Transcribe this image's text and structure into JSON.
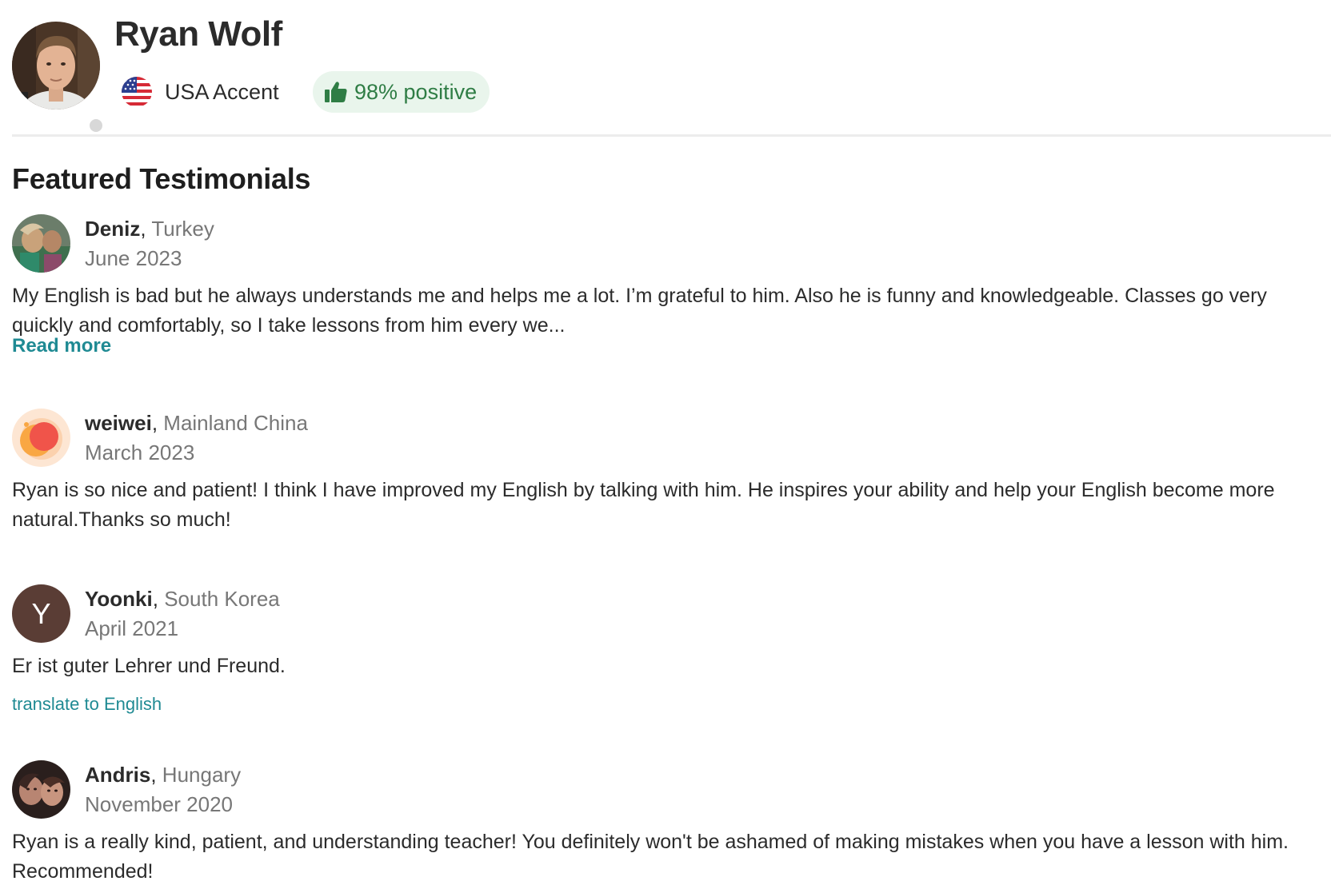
{
  "profile": {
    "name": "Ryan Wolf",
    "accent": "USA Accent",
    "accent_flag_icon": "us-flag-icon",
    "positive_rating": "98% positive",
    "positive_icon": "thumbs-up-icon",
    "status": "offline"
  },
  "colors": {
    "accent_teal": "#1f8a93",
    "positive_green": "#2f7d45",
    "positive_badge_bg": "#e9f5ec",
    "muted_text": "#777777"
  },
  "section": {
    "title": "Featured Testimonials"
  },
  "reviews": [
    {
      "name": "Deniz",
      "country": "Turkey",
      "date": "June 2023",
      "text": "My English is bad but he always understands me and helps me a lot. I’m grateful to him. Also he is funny and knowledgeable. Classes go very quickly and comfortably, so I take lessons from him every we...",
      "link": "Read more",
      "avatar_type": "photo"
    },
    {
      "name": "weiwei",
      "country": "Mainland China",
      "date": "March 2023",
      "text": "Ryan is so nice and patient! I think I have improved my English by talking with him. He inspires your ability and help your English become more natural.Thanks so much!",
      "avatar_type": "illustration"
    },
    {
      "name": "Yoonki",
      "country": "South Korea",
      "date": "April 2021",
      "text": "Er ist guter Lehrer und Freund.",
      "link": "translate to English",
      "avatar_type": "letter",
      "avatar_letter": "Y"
    },
    {
      "name": "Andris",
      "country": "Hungary",
      "date": "November 2020",
      "text": "Ryan is a really kind, patient, and understanding teacher! You definitely won't be ashamed of making mistakes when you have a lesson with him. Recommended!",
      "avatar_type": "photo"
    }
  ]
}
